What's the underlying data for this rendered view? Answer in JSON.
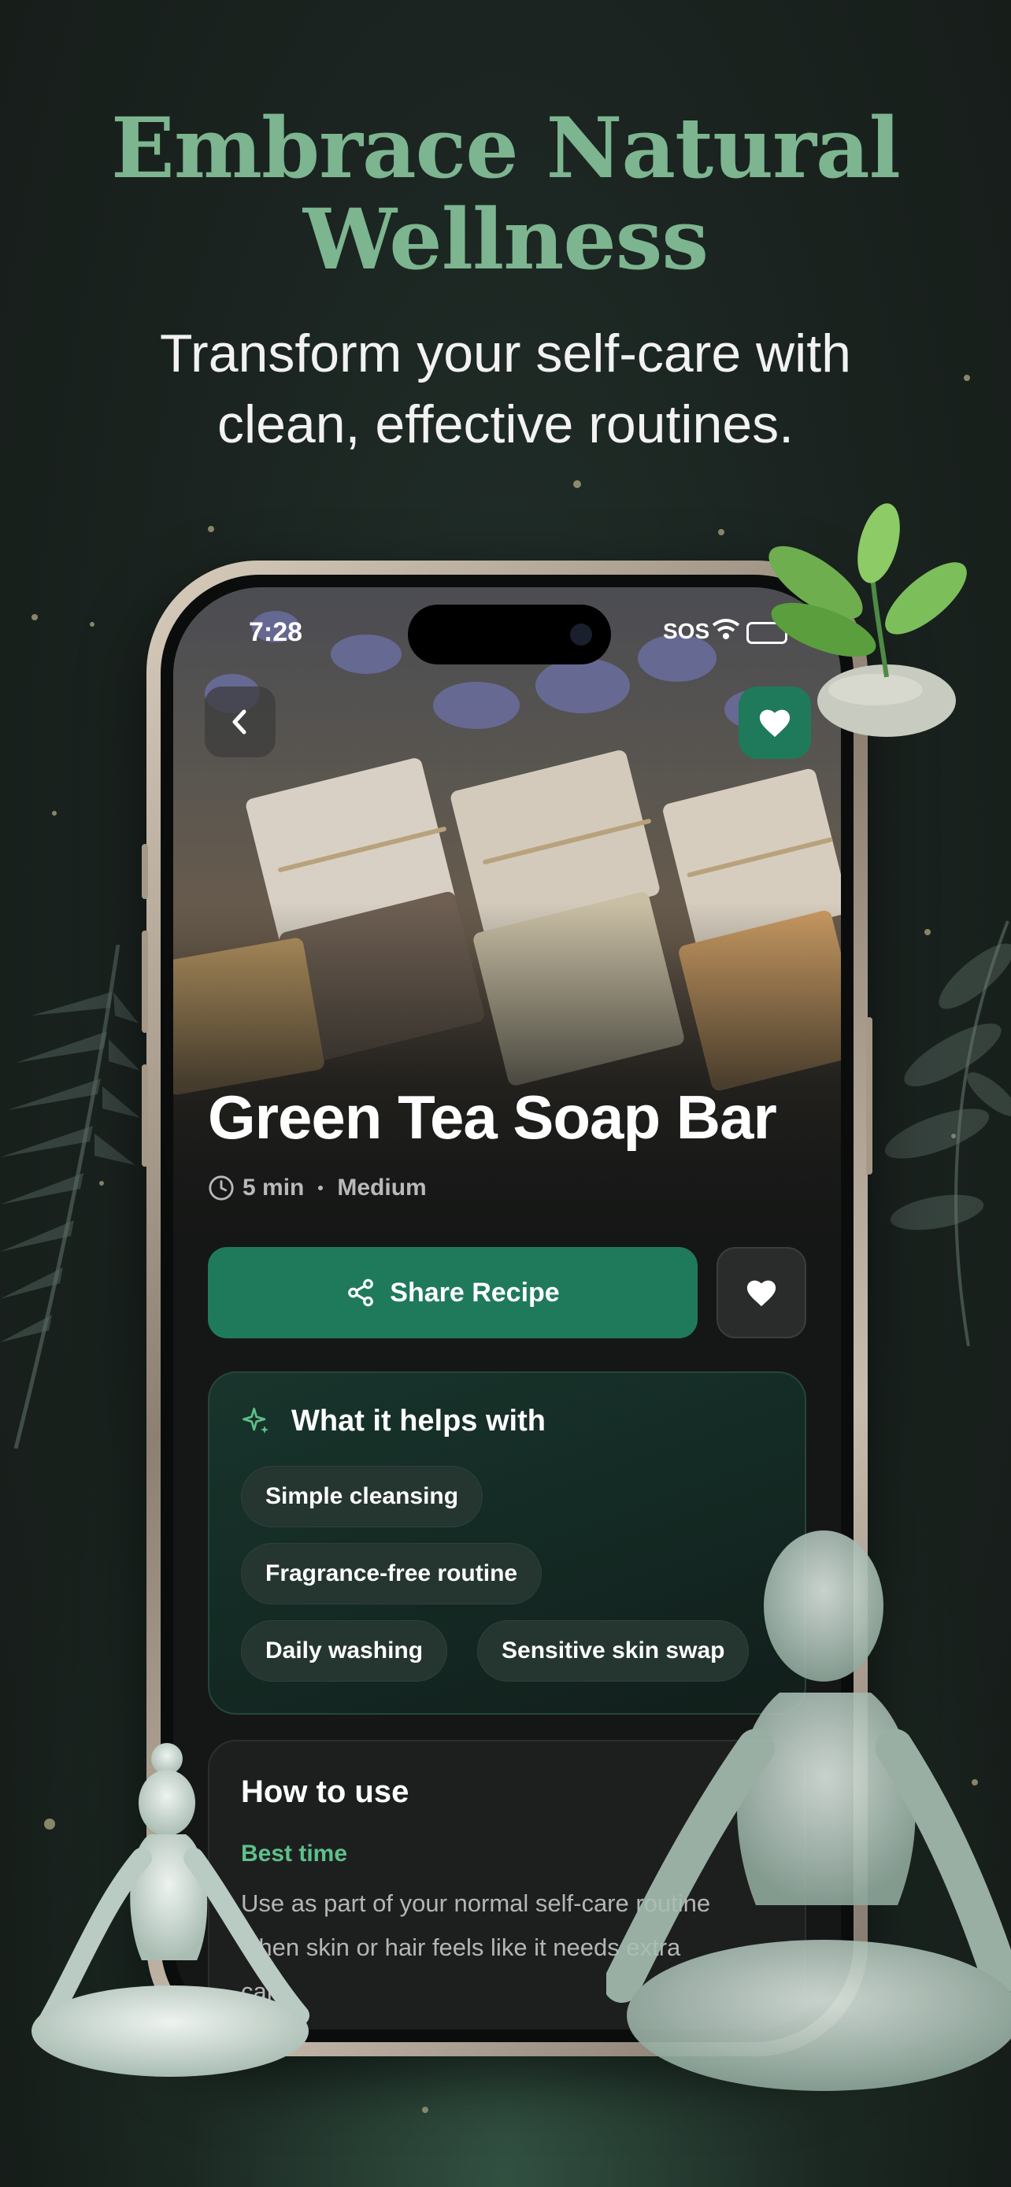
{
  "marketing": {
    "headline_line1": "Embrace Natural",
    "headline_line2": "Wellness",
    "subhead_line1": "Transform your self-care with",
    "subhead_line2": "clean, effective routines."
  },
  "status_bar": {
    "time": "7:28",
    "carrier": "SOS"
  },
  "recipe": {
    "title": "Green Tea Soap Bar",
    "duration": "5 min",
    "difficulty": "Medium",
    "share_label": "Share Recipe"
  },
  "helps_with": {
    "heading": "What it helps with",
    "chips": [
      "Simple cleansing",
      "Fragrance-free routine",
      "Daily washing",
      "Sensitive skin swap"
    ]
  },
  "how_to_use": {
    "heading": "How to use",
    "best_time_label": "Best time",
    "best_time_text": "Use as part of your normal self-care routine when skin or hair feels like it needs extra care."
  },
  "colors": {
    "accent_green": "#1f7a5c",
    "headline_green": "#7cb58f",
    "label_green": "#5fc08a"
  },
  "icons": [
    "chevron-left-icon",
    "heart-icon",
    "share-icon",
    "clock-icon",
    "sparkle-icon",
    "wifi-icon",
    "battery-icon"
  ]
}
